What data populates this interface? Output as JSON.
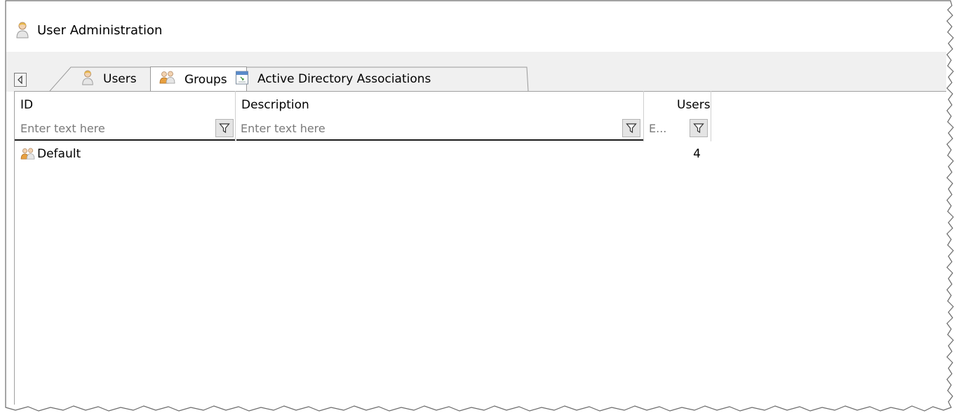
{
  "window": {
    "title": "User Administration",
    "title_icon": "user-icon"
  },
  "tabs": [
    {
      "label": "Users",
      "icon": "user-icon",
      "active": false
    },
    {
      "label": "Groups",
      "icon": "group-icon",
      "active": true
    },
    {
      "label": "Active Directory Associations",
      "icon": "directory-icon",
      "active": false
    }
  ],
  "grid": {
    "columns": [
      {
        "label": "ID",
        "filter_placeholder": "Enter text here"
      },
      {
        "label": "Description",
        "filter_placeholder": "Enter text here"
      },
      {
        "label": "Users",
        "filter_placeholder": "E..."
      }
    ],
    "rows": [
      {
        "icon": "group-icon",
        "id": "Default",
        "description": "",
        "users": "4"
      }
    ]
  },
  "colors": {
    "tab_strip_bg": "#f0f0f0",
    "border": "#a0a0a0",
    "filter_underline": "#1a1a1a"
  }
}
